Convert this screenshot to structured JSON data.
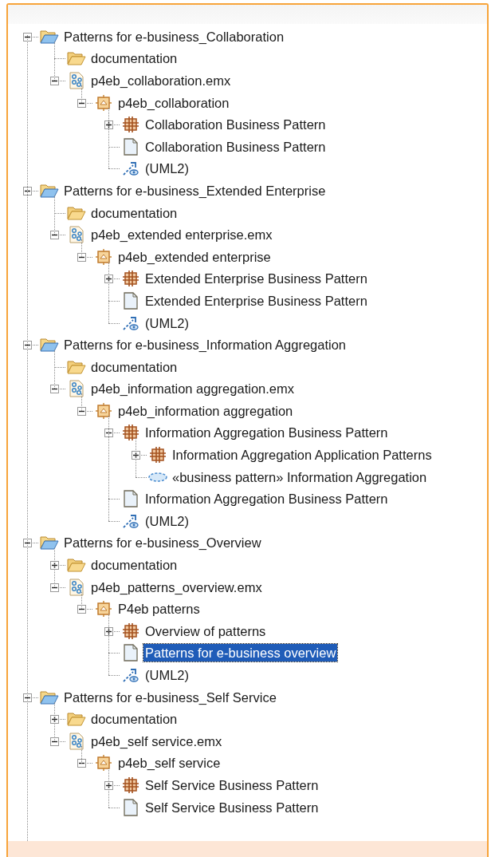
{
  "tree": [
    {
      "kind": "folder",
      "label": "Patterns for e-business_Collaboration",
      "expanded": true,
      "selected": false,
      "children": [
        {
          "kind": "doc-folder",
          "label": "documentation",
          "selected": false
        },
        {
          "kind": "model",
          "label": "p4eb_collaboration.emx",
          "expanded": true,
          "selected": false,
          "children": [
            {
              "kind": "package",
              "label": "p4eb_collaboration",
              "expanded": true,
              "selected": false,
              "children": [
                {
                  "kind": "pattern",
                  "label": "Collaboration Business Pattern",
                  "expanded": false,
                  "selected": false
                },
                {
                  "kind": "document",
                  "label": "Collaboration Business Pattern",
                  "selected": false
                },
                {
                  "kind": "profile",
                  "label": "(UML2)",
                  "selected": false
                }
              ]
            }
          ]
        }
      ]
    },
    {
      "kind": "folder",
      "label": "Patterns for e-business_Extended Enterprise",
      "expanded": true,
      "selected": false,
      "children": [
        {
          "kind": "doc-folder",
          "label": "documentation",
          "selected": false
        },
        {
          "kind": "model",
          "label": "p4eb_extended enterprise.emx",
          "expanded": true,
          "selected": false,
          "children": [
            {
              "kind": "package",
              "label": "p4eb_extended enterprise",
              "expanded": true,
              "selected": false,
              "children": [
                {
                  "kind": "pattern",
                  "label": "Extended Enterprise Business Pattern",
                  "expanded": false,
                  "selected": false
                },
                {
                  "kind": "document",
                  "label": "Extended Enterprise Business Pattern",
                  "selected": false
                },
                {
                  "kind": "profile",
                  "label": "(UML2)",
                  "selected": false
                }
              ]
            }
          ]
        }
      ]
    },
    {
      "kind": "folder",
      "label": "Patterns for e-business_Information Aggregation",
      "expanded": true,
      "selected": false,
      "children": [
        {
          "kind": "doc-folder",
          "label": "documentation",
          "selected": false
        },
        {
          "kind": "model",
          "label": "p4eb_information aggregation.emx",
          "expanded": true,
          "selected": false,
          "children": [
            {
              "kind": "package",
              "label": "p4eb_information aggregation",
              "expanded": true,
              "selected": false,
              "children": [
                {
                  "kind": "pattern",
                  "label": "Information Aggregation Business Pattern",
                  "expanded": true,
                  "selected": false,
                  "children": [
                    {
                      "kind": "pattern",
                      "label": "Information Aggregation Application Patterns",
                      "expanded": false,
                      "selected": false
                    },
                    {
                      "kind": "collaboration",
                      "label": "«business pattern» Information Aggregation",
                      "selected": false
                    }
                  ]
                },
                {
                  "kind": "document",
                  "label": "Information Aggregation Business Pattern",
                  "selected": false
                },
                {
                  "kind": "profile",
                  "label": "(UML2)",
                  "selected": false
                }
              ]
            }
          ]
        }
      ]
    },
    {
      "kind": "folder",
      "label": "Patterns for e-business_Overview",
      "expanded": true,
      "selected": false,
      "children": [
        {
          "kind": "doc-folder",
          "label": "documentation",
          "expanded": false,
          "selected": false
        },
        {
          "kind": "model",
          "label": "p4eb_patterns_overview.emx",
          "expanded": true,
          "selected": false,
          "children": [
            {
              "kind": "package",
              "label": "P4eb patterns",
              "expanded": true,
              "selected": false,
              "children": [
                {
                  "kind": "pattern",
                  "label": "Overview of patterns",
                  "expanded": false,
                  "selected": false
                },
                {
                  "kind": "document",
                  "label": "Patterns for e-business overview",
                  "selected": true
                },
                {
                  "kind": "profile",
                  "label": "(UML2)",
                  "selected": false
                }
              ]
            }
          ]
        }
      ]
    },
    {
      "kind": "folder",
      "label": "Patterns for e-business_Self Service",
      "expanded": true,
      "selected": false,
      "children": [
        {
          "kind": "doc-folder",
          "label": "documentation",
          "expanded": false,
          "selected": false
        },
        {
          "kind": "model",
          "label": "p4eb_self service.emx",
          "expanded": true,
          "selected": false,
          "children": [
            {
              "kind": "package",
              "label": "p4eb_self service",
              "expanded": true,
              "selected": false,
              "children": [
                {
                  "kind": "pattern",
                  "label": "Self Service Business Pattern",
                  "expanded": false,
                  "selected": false
                },
                {
                  "kind": "document",
                  "label": "Self Service Business Pattern",
                  "selected": false
                }
              ]
            }
          ]
        }
      ]
    }
  ]
}
